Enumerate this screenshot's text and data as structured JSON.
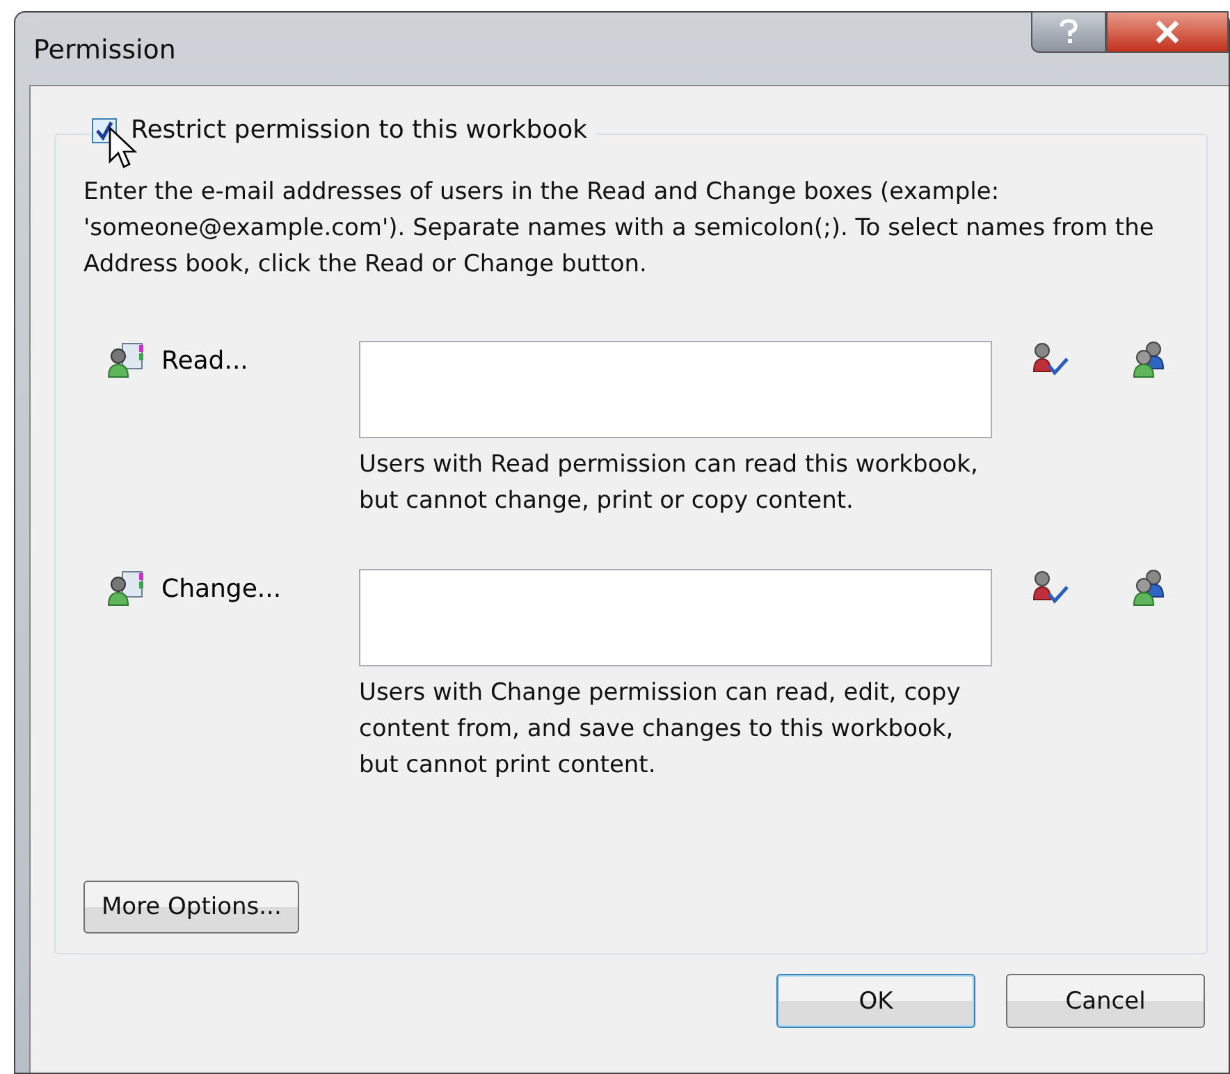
{
  "window": {
    "title": "Permission"
  },
  "restrict": {
    "label": "Restrict permission to this workbook",
    "checked": true
  },
  "instructions": "Enter the e-mail addresses of users in the Read and Change boxes (example: 'someone@example.com'). Separate names with a semicolon(;). To select names from the Address book, click the Read or Change button.",
  "permissions": [
    {
      "label": "Read...",
      "description": "Users with Read permission can read this workbook, but cannot change, print or copy content."
    },
    {
      "label": "Change...",
      "description": "Users with Change permission can read, edit, copy content from, and save changes to this workbook, but cannot print content."
    }
  ],
  "more_options": "More Options...",
  "buttons": [
    {
      "label": "OK",
      "default": true
    },
    {
      "label": "Cancel",
      "default": false
    }
  ]
}
